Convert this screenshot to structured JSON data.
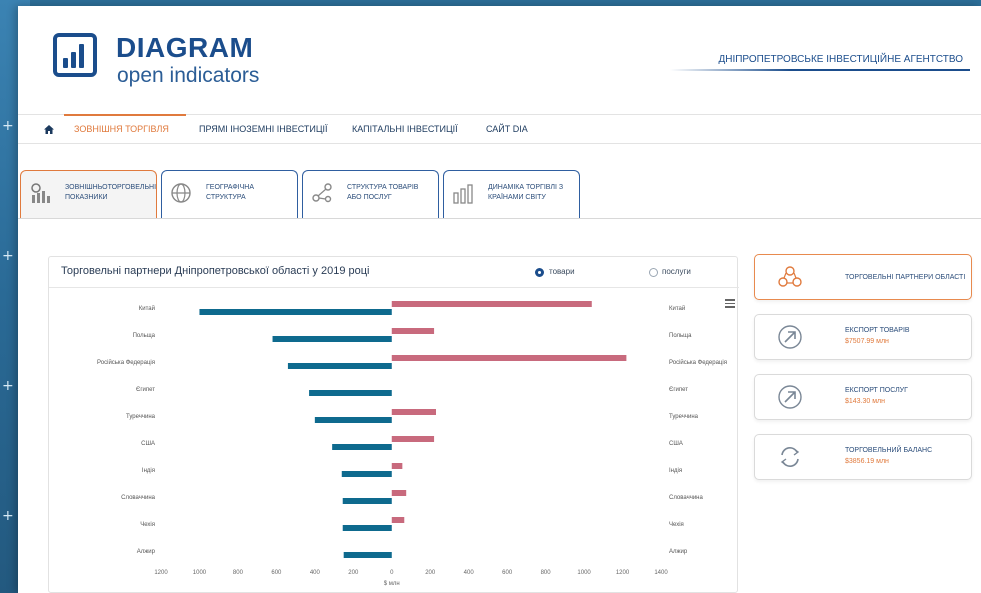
{
  "brand": {
    "title": "DIAGRAM",
    "subtitle": "open indicators"
  },
  "agency": "ДНІПРОПЕТРОВСЬКЕ ІНВЕСТИЦІЙНЕ АГЕНТСТВО",
  "nav": {
    "items": [
      {
        "label": "ЗОВНІШНЯ ТОРГІВЛЯ",
        "active": true
      },
      {
        "label": "ПРЯМІ ІНОЗЕМНІ ІНВЕСТИЦІЇ",
        "active": false
      },
      {
        "label": "КАПІТАЛЬНІ ІНВЕСТИЦІЇ",
        "active": false
      },
      {
        "label": "САЙТ DIA",
        "active": false
      }
    ]
  },
  "tabs": [
    {
      "label": "ЗОВНІШНЬОТОРГОВЕЛЬНІ\nПОКАЗНИКИ",
      "icon": "indicators-icon",
      "active": true
    },
    {
      "label": "ГЕОГРАФІЧНА\nСТРУКТУРА",
      "icon": "globe-icon",
      "active": false
    },
    {
      "label": "СТРУКТУРА ТОВАРІВ\nАБО ПОСЛУГ",
      "icon": "structure-icon",
      "active": false
    },
    {
      "label": "ДИНАМІКА ТОРГІВЛІ З\nКРАЇНАМИ СВІТУ",
      "icon": "dynamics-icon",
      "active": false
    }
  ],
  "chart_panel": {
    "title": "Торговельні партнери Дніпропетровської області у 2019 році",
    "radio_goods": "товари",
    "radio_services": "послуги",
    "goods_selected": true
  },
  "chart_data": {
    "type": "bar",
    "orientation": "horizontal-butterfly",
    "categories": [
      "Китай",
      "Польща",
      "Російська Федерація",
      "Єгипет",
      "Туреччина",
      "США",
      "Індія",
      "Словаччина",
      "Чехія",
      "Алжир"
    ],
    "series": [
      {
        "values": [
          -1000,
          -620,
          -540,
          -430,
          -400,
          -310,
          -260,
          -255,
          -255,
          -250
        ],
        "color": "#0e6a8e"
      },
      {
        "values": [
          1040,
          220,
          1220,
          0,
          230,
          220,
          55,
          75,
          65,
          0
        ],
        "color": "#c86a7d"
      }
    ],
    "xlim": [
      -1200,
      1400
    ],
    "xticks": [
      "1200",
      "1000",
      "800",
      "600",
      "400",
      "200",
      "0",
      "200",
      "400",
      "600",
      "800",
      "1000",
      "1200",
      "1400"
    ],
    "xlabel": "$ млн",
    "grid": false
  },
  "side_cards": [
    {
      "label": "ТОРГОВЕЛЬНІ ПАРТНЕРИ ОБЛАСТІ",
      "value": "",
      "icon": "partners-icon",
      "highlight": true
    },
    {
      "label": "ЕКСПОРТ ТОВАРІВ",
      "value": "$7507.99 млн",
      "icon": "export-arrow-icon",
      "highlight": false
    },
    {
      "label": "ЕКСПОРТ ПОСЛУГ",
      "value": "$143.30 млн",
      "icon": "export-arrow-icon",
      "highlight": false
    },
    {
      "label": "ТОРГОВЕЛЬНИЙ БАЛАНС",
      "value": "$3856.19 млн",
      "icon": "balance-cycle-icon",
      "highlight": false
    }
  ]
}
